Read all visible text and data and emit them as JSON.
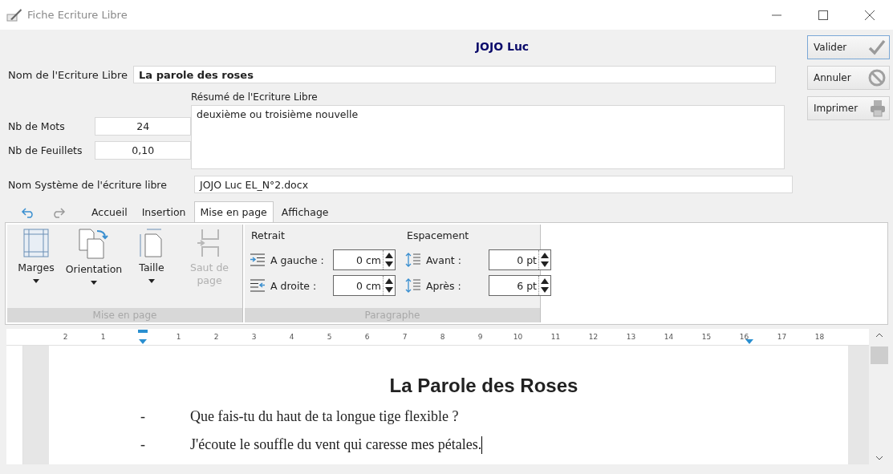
{
  "window": {
    "title": "Fiche Ecriture Libre"
  },
  "header": {
    "author": "JOJO Luc"
  },
  "form": {
    "name_label": "Nom de l'Ecriture Libre",
    "name_value": "La parole des roses",
    "summary_label": "Résumé de l'Ecriture Libre",
    "summary_value": "deuxième ou troisième nouvelle",
    "stats": [
      {
        "label": "Nb de Mots",
        "value": "24"
      },
      {
        "label": "Nb de Feuillets",
        "value": "0,10"
      }
    ],
    "system_label": "Nom Système de l'écriture libre",
    "system_value": "JOJO Luc EL_N°2.docx"
  },
  "actions": [
    {
      "label": "Valider",
      "kind": "check",
      "selected": true
    },
    {
      "label": "Annuler",
      "kind": "cancel",
      "selected": false
    },
    {
      "label": "Imprimer",
      "kind": "print",
      "selected": false
    }
  ],
  "tabs": [
    {
      "label": "Accueil",
      "selected": false
    },
    {
      "label": "Insertion",
      "selected": false
    },
    {
      "label": "Mise en page",
      "selected": true
    },
    {
      "label": "Affichage",
      "selected": false
    }
  ],
  "ribbon": {
    "page_group": {
      "label": "Mise en page",
      "buttons": [
        {
          "label": "Marges",
          "kind": "margins",
          "dropdown": true,
          "disabled": false
        },
        {
          "label": "Orientation",
          "kind": "orientation",
          "dropdown": true,
          "disabled": false
        },
        {
          "label": "Taille",
          "kind": "size",
          "dropdown": true,
          "disabled": false
        },
        {
          "label": "Saut de page",
          "kind": "break",
          "dropdown": false,
          "disabled": true
        }
      ]
    },
    "paragraph_group": {
      "label": "Paragraphe",
      "columns": [
        {
          "title": "Retrait",
          "fields": [
            {
              "label": "A gauche :",
              "value": "0 cm",
              "kind": "left"
            },
            {
              "label": "A droite :",
              "value": "0 cm",
              "kind": "right"
            }
          ]
        },
        {
          "title": "Espacement",
          "fields": [
            {
              "label": "Avant :",
              "value": "0 pt",
              "kind": "before"
            },
            {
              "label": "Après :",
              "value": "6 pt",
              "kind": "after"
            }
          ]
        }
      ]
    }
  },
  "ruler": {
    "left_labels": [
      "2",
      "1"
    ],
    "right_labels": [
      "1",
      "2",
      "3",
      "4",
      "5",
      "6",
      "7",
      "8",
      "9",
      "10",
      "11",
      "12",
      "13",
      "14",
      "15",
      "16",
      "17",
      "18"
    ]
  },
  "document": {
    "title": "La Parole des Roses",
    "lines": [
      {
        "bullet": "-",
        "text": "Que fais-tu du haut de ta longue tige flexible ?"
      },
      {
        "bullet": "-",
        "text": "J'écoute le souffle du vent qui caresse mes pétales."
      }
    ]
  }
}
